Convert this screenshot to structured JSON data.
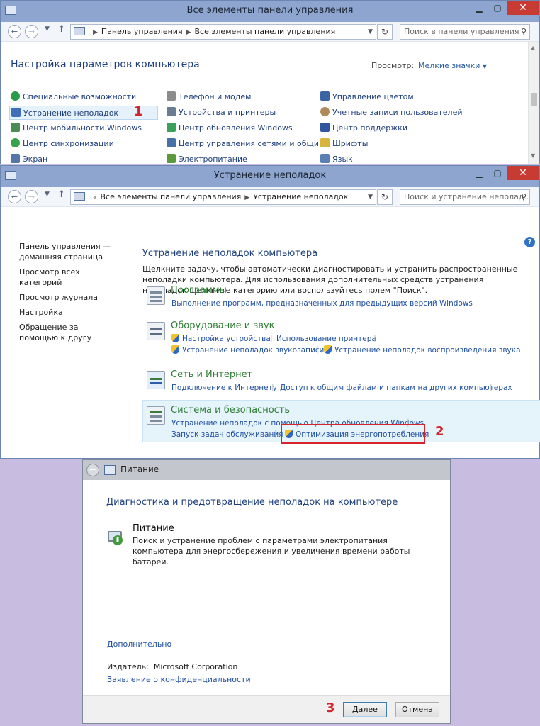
{
  "win1": {
    "title": "Все элементы панели управления",
    "path": [
      "Панель управления",
      "Все элементы панели управления"
    ],
    "search_placeholder": "Поиск в панели управления",
    "heading": "Настройка параметров компьютера",
    "view_label": "Просмотр:",
    "view_value": "Мелкие значки",
    "col1": [
      "Специальные возможности",
      "Устранение неполадок",
      "Центр мобильности Windows",
      "Центр синхронизации",
      "Экран"
    ],
    "col2": [
      "Телефон и модем",
      "Устройства и принтеры",
      "Центр обновления Windows",
      "Центр управления сетями и общи...",
      "Электропитание"
    ],
    "col3": [
      "Управление цветом",
      "Учетные записи пользователей",
      "Центр поддержки",
      "Шрифты",
      "Язык"
    ],
    "marker": "1"
  },
  "win2": {
    "title": "Устранение неполадок",
    "path": [
      "Все элементы панели управления",
      "Устранение неполадок"
    ],
    "search_placeholder": "Поиск и устранение неполад...",
    "left_nav": [
      "Панель управления — домашняя страница",
      "Просмотр всех категорий",
      "Просмотр журнала",
      "Настройка",
      "Обращение за помощью к другу"
    ],
    "heading": "Устранение неполадок компьютера",
    "description": "Щелкните задачу, чтобы автоматически диагностировать и устранить распространенные неполадки компьютера. Для использования дополнительных средств устранения неполадок щелкните категорию или воспользуйтесь полем \"Поиск\".",
    "categories": [
      {
        "title": "Программы",
        "links": [
          "Выполнение программ, предназначенных для предыдущих версий Windows"
        ]
      },
      {
        "title": "Оборудование и звук",
        "links": [
          "Настройка устройства",
          "Использование принтера",
          "Устранение неполадок звукозаписи",
          "Устранение неполадок воспроизведения звука"
        ]
      },
      {
        "title": "Сеть и Интернет",
        "links": [
          "Подключение к Интернету",
          "Доступ к общим файлам и папкам на других компьютерах"
        ]
      },
      {
        "title": "Система и безопасность",
        "links": [
          "Устранение неполадок с помощью Центра обновления Windows",
          "Запуск задач обслуживания",
          "Оптимизация энергопотребления"
        ]
      }
    ],
    "marker": "2"
  },
  "dialog": {
    "title": "Питание",
    "heading": "Диагностика и предотвращение неполадок на компьютере",
    "item_name": "Питание",
    "item_desc": "Поиск и устранение проблем с параметрами электропитания компьютера для энергосбережения и увеличения  времени работы батареи.",
    "advanced": "Дополнительно",
    "publisher_label": "Издатель:",
    "publisher": "Microsoft Corporation",
    "privacy": "Заявление о конфиденциальности",
    "next": "Далее",
    "cancel": "Отмена",
    "marker": "3"
  },
  "colors": {
    "accent": "#1e3f7c",
    "category_title": "#2f7d35",
    "link": "#1e4e9f",
    "marker": "#d7232b"
  }
}
